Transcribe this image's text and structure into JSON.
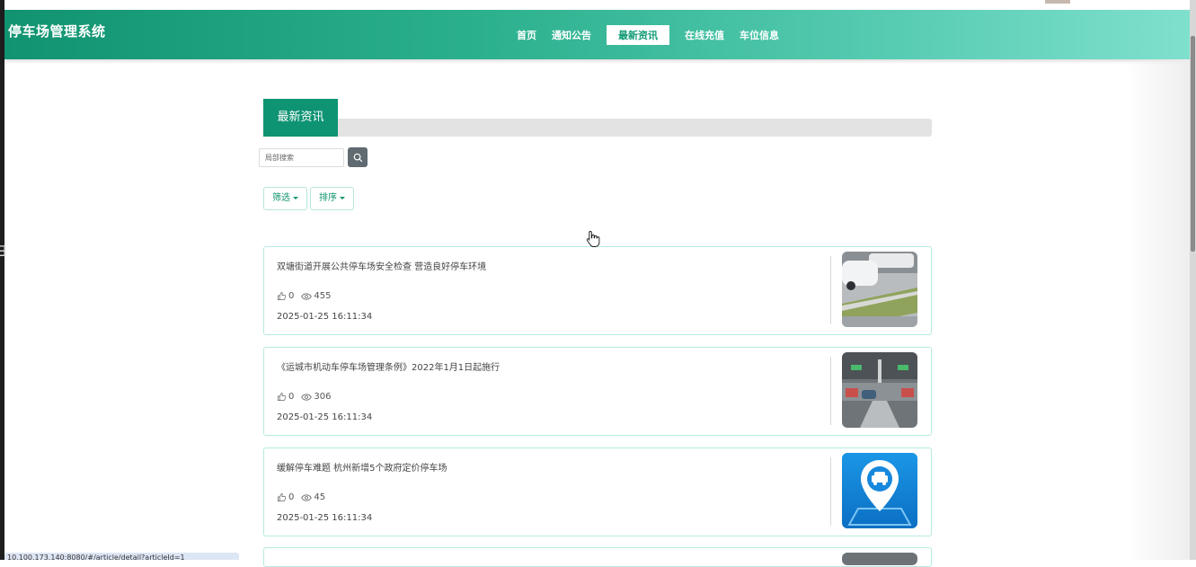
{
  "header": {
    "title": "停车场管理系统",
    "nav": [
      {
        "label": "首页",
        "active": false
      },
      {
        "label": "通知公告",
        "active": false
      },
      {
        "label": "最新资讯",
        "active": true
      },
      {
        "label": "在线充值",
        "active": false
      },
      {
        "label": "车位信息",
        "active": false
      }
    ]
  },
  "section": {
    "title": "最新资讯"
  },
  "search": {
    "placeholder": "局部搜索",
    "button_icon": "search-icon"
  },
  "filters": {
    "filter_label": "筛选",
    "sort_label": "排序"
  },
  "news": [
    {
      "title": "双塘街道开展公共停车场安全检查 营造良好停车环境",
      "likes": "0",
      "views": "455",
      "date": "2025-01-25 16:11:34",
      "thumb": "parking-lot-photo"
    },
    {
      "title": "《运城市机动车停车场管理条例》2022年1月1日起施行",
      "likes": "0",
      "views": "306",
      "date": "2025-01-25 16:11:34",
      "thumb": "underground-garage-photo"
    },
    {
      "title": "缓解停车难题 杭州新增5个政府定价停车场",
      "likes": "0",
      "views": "45",
      "date": "2025-01-25 16:11:34",
      "thumb": "parking-location-icon"
    }
  ],
  "status_bar": {
    "url": "10.100.173.140:8080/#/article/detail?articleId=1"
  },
  "colors": {
    "primary": "#0f9473",
    "header_end": "#7fe0cd",
    "card_border": "#b6ebe1"
  }
}
